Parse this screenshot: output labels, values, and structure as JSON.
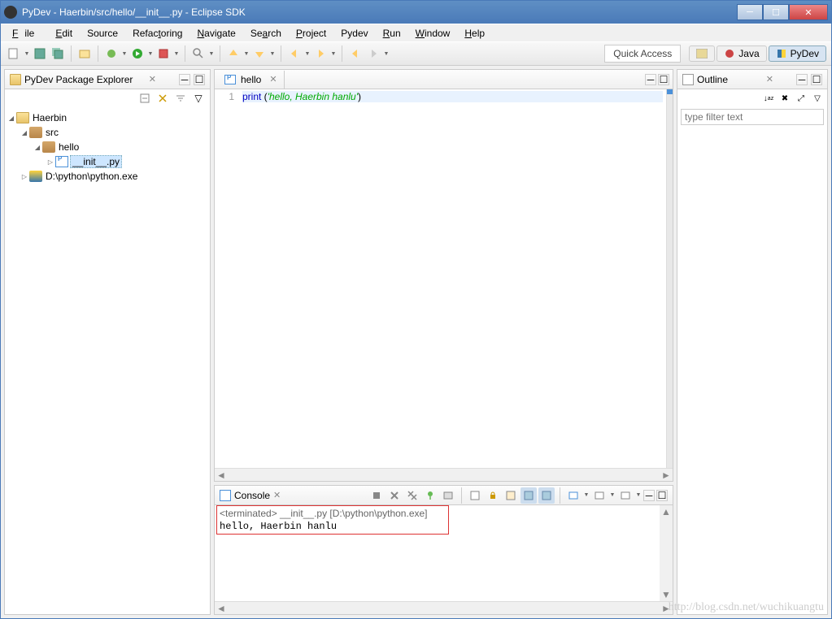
{
  "window": {
    "title": "PyDev - Haerbin/src/hello/__init__.py - Eclipse SDK"
  },
  "menu": {
    "file": "File",
    "edit": "Edit",
    "source": "Source",
    "refactoring": "Refactoring",
    "navigate": "Navigate",
    "search": "Search",
    "project": "Project",
    "pydev": "Pydev",
    "run": "Run",
    "window": "Window",
    "help": "Help"
  },
  "toolbar": {
    "quick_access": "Quick Access",
    "perspectives": {
      "java": "Java",
      "pydev": "PyDev"
    }
  },
  "package_explorer": {
    "title": "PyDev Package Explorer",
    "tree": {
      "project": "Haerbin",
      "src": "src",
      "pkg": "hello",
      "file": "__init__.py",
      "python_path": "D:\\python\\python.exe"
    }
  },
  "editor": {
    "tab_title": "hello",
    "line_number": "1",
    "code": {
      "keyword": "print",
      "paren_open": " (",
      "string": "'hello, Haerbin hanlu'",
      "paren_close": ")"
    }
  },
  "console": {
    "title": "Console",
    "subtitle": "<terminated> __init__.py [D:\\python\\python.exe]",
    "output": "hello, Haerbin hanlu"
  },
  "outline": {
    "title": "Outline",
    "filter_placeholder": "type filter text"
  },
  "watermark": "http://blog.csdn.net/wuchikuangtu"
}
